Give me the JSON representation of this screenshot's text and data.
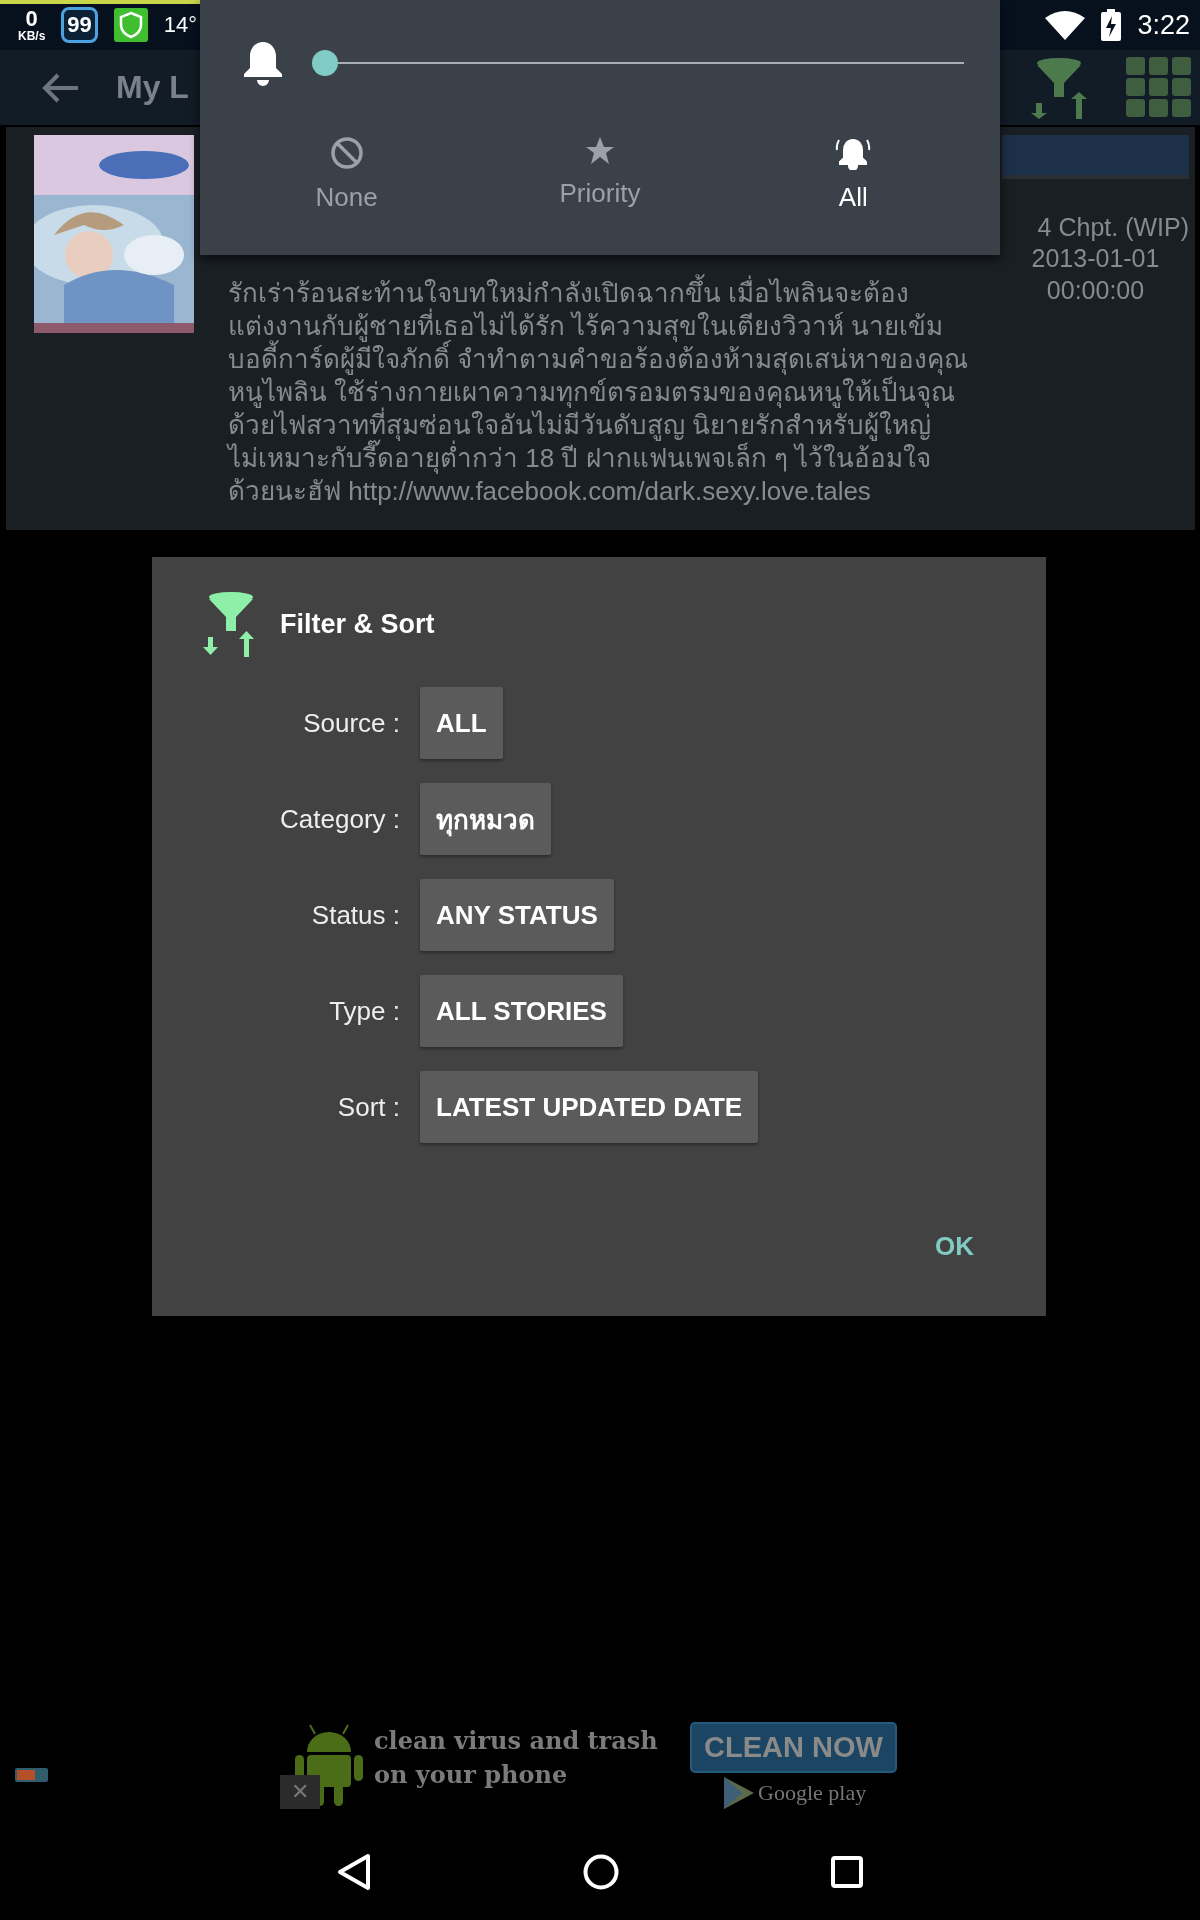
{
  "loading": {
    "level": 0.19
  },
  "status_bar": {
    "speed": "0",
    "speed_unit": "KB/s",
    "badge": "99",
    "temperature": "14°",
    "time": "3:22"
  },
  "toolbar": {
    "title": "My L"
  },
  "book": {
    "chapters": "4 Chpt. (WIP)",
    "date": "2013-01-01",
    "time": "00:00:00",
    "description": "รักเร่าร้อนสะท้านใจบทใหม่กำลังเปิดฉากขึ้น เมื่อไพลินจะต้อง\nแต่งงานกับผู้ชายที่เธอไม่ได้รัก ไร้ความสุขในเตียงวิวาห์ นายเข้ม\nบอดี้การ์ดผู้มีใจภักดิ์ จำทำตามคำขอร้องต้องห้ามสุดเสน่หาของคุณ\nหนูไพลิน ใช้ร่างกายเผาความทุกข์ตรอมตรมของคุณหนูให้เป็นจุณ\nด้วยไฟสวาทที่สุมซ่อนใจอันไม่มีวันดับสูญ นิยายรักสำหรับผู้ใหญ่\nไม่เหมาะกับรี๊ดอายุต่ำกว่า 18 ปี  ฝากแฟนเพจเล็ก ๆ ไว้ในอ้อมใจ\nด้วยนะฮัฟ http://www.facebook.com/dark.sexy.love.tales"
  },
  "volume_panel": {
    "level": 0,
    "modes": [
      {
        "kind": "none",
        "label": "None",
        "selected": false
      },
      {
        "kind": "priority",
        "label": "Priority",
        "selected": false
      },
      {
        "kind": "all",
        "label": "All",
        "selected": true
      }
    ]
  },
  "dialog": {
    "title": "Filter & Sort",
    "fields": [
      {
        "label": "Source :",
        "value": "ALL"
      },
      {
        "label": "Category :",
        "value": "ทุกหมวด"
      },
      {
        "label": "Status :",
        "value": "ANY STATUS"
      },
      {
        "label": "Type :",
        "value": "ALL STORIES"
      },
      {
        "label": "Sort :",
        "value": "LATEST UPDATED DATE"
      }
    ],
    "ok": "OK"
  },
  "ad": {
    "headline": "clean virus and trash\non your phone",
    "button": "CLEAN NOW",
    "store": "Google play",
    "close": "✕"
  }
}
